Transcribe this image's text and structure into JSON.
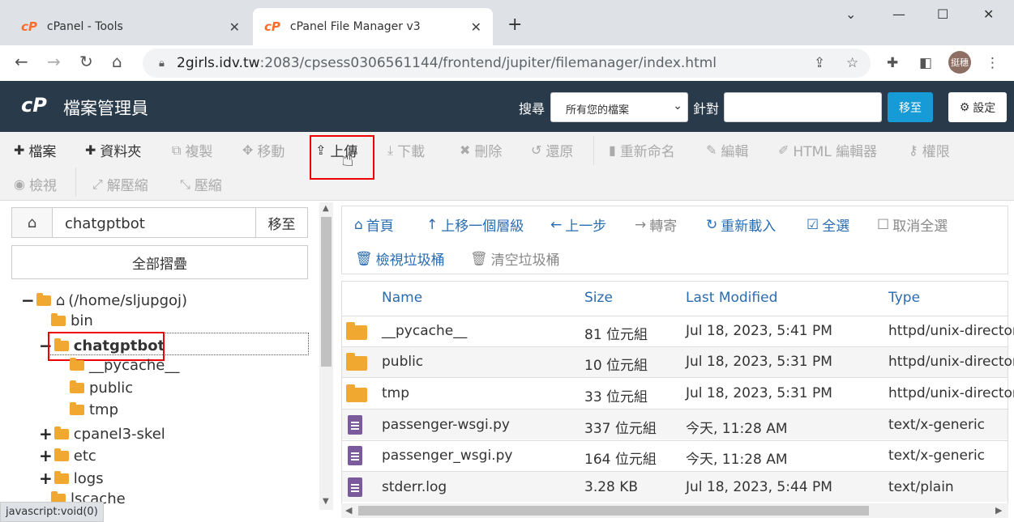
{
  "browser": {
    "tabs": [
      {
        "label": "cPanel - Tools",
        "favicon": "cP"
      },
      {
        "label": "cPanel File Manager v3",
        "favicon": "cP"
      }
    ],
    "url_host": "2girls.idv.tw",
    "url_path": ":2083/cpsess0306561144/frontend/jupiter/filemanager/index.html",
    "avatar": "挺穗",
    "status_text": "javascript:void(0)"
  },
  "header": {
    "logo": "cP",
    "title": "檔案管理員",
    "search_label": "搜尋",
    "search_scope": "所有您的檔案",
    "for_label": "針對",
    "go_label": "移至",
    "settings_label": "設定"
  },
  "toolbar": {
    "file": "檔案",
    "folder": "資料夾",
    "copy": "複製",
    "move": "移動",
    "upload": "上傳",
    "download": "下載",
    "delete": "刪除",
    "restore": "還原",
    "rename": "重新命名",
    "edit": "編輯",
    "html_editor": "HTML 編輯器",
    "permissions": "權限",
    "view": "檢視",
    "extract": "解壓縮",
    "compress": "壓縮"
  },
  "left": {
    "path_value": "chatgptbot",
    "go_label": "移至",
    "collapse_label": "全部摺疊",
    "tree": {
      "root": "(/home/sljupgoj)",
      "bin": "bin",
      "chatgptbot": "chatgptbot",
      "pycache": "__pycache__",
      "public": "public",
      "tmp": "tmp",
      "cpanel3": "cpanel3-skel",
      "etc": "etc",
      "logs": "logs",
      "lscache": "lscache"
    }
  },
  "nav": {
    "home": "首頁",
    "up": "上移一個層級",
    "back": "上一步",
    "forward": "轉寄",
    "reload": "重新載入",
    "select_all": "全選",
    "unselect_all": "取消全選",
    "view_trash": "檢視垃圾桶",
    "empty_trash": "清空垃圾桶"
  },
  "table": {
    "headers": {
      "name": "Name",
      "size": "Size",
      "modified": "Last Modified",
      "type": "Type"
    },
    "rows": [
      {
        "name": "__pycache__",
        "size": "81 位元組",
        "modified": "Jul 18, 2023, 5:41 PM",
        "type": "httpd/unix-directory"
      },
      {
        "name": "public",
        "size": "10 位元組",
        "modified": "Jul 18, 2023, 5:31 PM",
        "type": "httpd/unix-directory"
      },
      {
        "name": "tmp",
        "size": "33 位元組",
        "modified": "Jul 18, 2023, 5:31 PM",
        "type": "httpd/unix-directory"
      },
      {
        "name": "passenger-wsgi.py",
        "size": "337 位元組",
        "modified": "今天, 11:28 AM",
        "type": "text/x-generic"
      },
      {
        "name": "passenger_wsgi.py",
        "size": "164 位元組",
        "modified": "今天, 11:28 AM",
        "type": "text/x-generic"
      },
      {
        "name": "stderr.log",
        "size": "3.28 KB",
        "modified": "Jul 18, 2023, 5:44 PM",
        "type": "text/plain"
      }
    ]
  }
}
